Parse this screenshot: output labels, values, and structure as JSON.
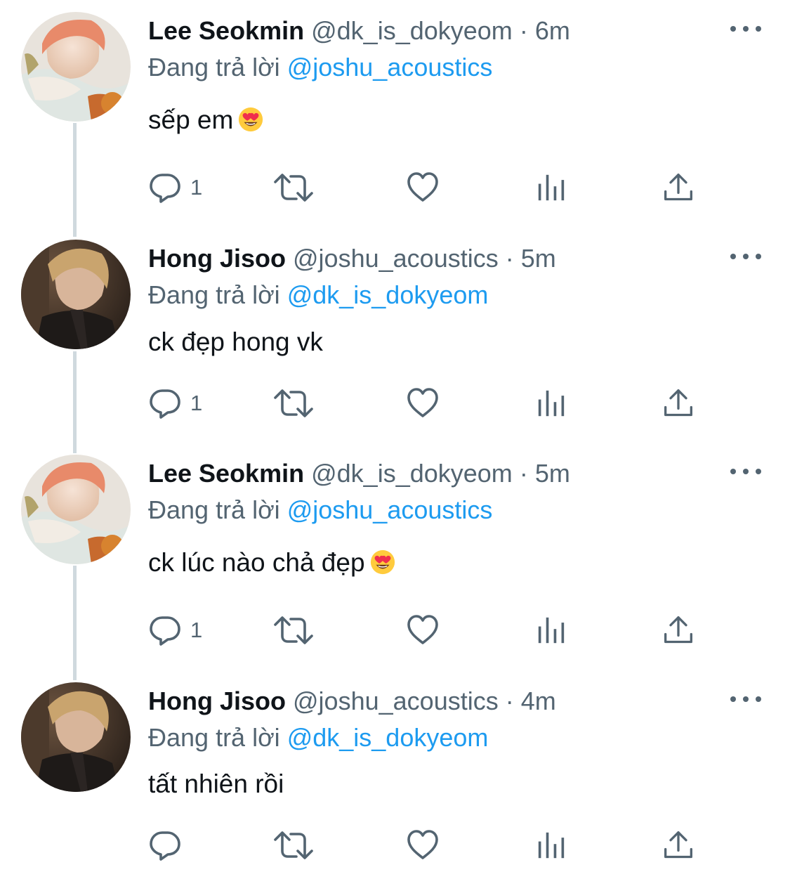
{
  "reply_prefix": "Đang trả lời",
  "colors": {
    "text": "#0f1419",
    "secondary": "#536471",
    "link": "#1d9bf0",
    "thread_line": "#cfd9de"
  },
  "icons": {
    "reply": "reply-icon",
    "retweet": "retweet-icon",
    "like": "heart-icon",
    "views": "analytics-icon",
    "share": "share-icon",
    "more": "more-icon"
  },
  "tweets": [
    {
      "display_name": "Lee Seokmin",
      "handle": "@dk_is_dokyeom",
      "separator": "·",
      "time": "6m",
      "replying_to": "@joshu_acoustics",
      "text": "sếp em",
      "emoji": "smiling-face-with-heart-eyes",
      "reply_count": "1"
    },
    {
      "display_name": "Hong Jisoo",
      "handle": "@joshu_acoustics",
      "separator": "·",
      "time": "5m",
      "replying_to": "@dk_is_dokyeom",
      "text": "ck đẹp hong vk",
      "emoji": "",
      "reply_count": "1"
    },
    {
      "display_name": "Lee Seokmin",
      "handle": "@dk_is_dokyeom",
      "separator": "·",
      "time": "5m",
      "replying_to": "@joshu_acoustics",
      "text": "ck lúc nào chả đẹp",
      "emoji": "smiling-face-with-heart-eyes",
      "reply_count": "1"
    },
    {
      "display_name": "Hong Jisoo",
      "handle": "@joshu_acoustics",
      "separator": "·",
      "time": "4m",
      "replying_to": "@dk_is_dokyeom",
      "text": "tất nhiên rồi",
      "emoji": "",
      "reply_count": ""
    }
  ]
}
